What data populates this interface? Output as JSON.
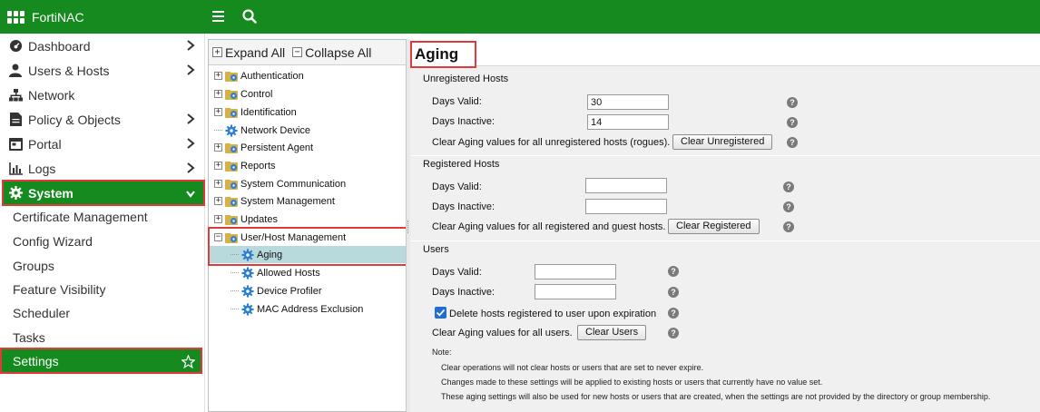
{
  "app": {
    "title": "FortiNAC"
  },
  "colors": {
    "brand_green": "#148a1f",
    "highlight_red": "#e03a3a",
    "tree_selected": "#b9dadd"
  },
  "topbar": {
    "menu_icon": "hamburger-menu-icon",
    "search_icon": "search-icon"
  },
  "nav": {
    "items": [
      {
        "label": "Dashboard",
        "icon": "dashboard-gauge-icon"
      },
      {
        "label": "Users & Hosts",
        "icon": "user-icon"
      },
      {
        "label": "Network",
        "icon": "network-icon"
      },
      {
        "label": "Policy & Objects",
        "icon": "policy-document-icon"
      },
      {
        "label": "Portal",
        "icon": "portal-icon"
      },
      {
        "label": "Logs",
        "icon": "logs-chart-icon"
      },
      {
        "label": "System",
        "icon": "gear-icon"
      }
    ],
    "system_sub": [
      {
        "label": "Certificate Management"
      },
      {
        "label": "Config Wizard"
      },
      {
        "label": "Groups"
      },
      {
        "label": "Feature Visibility"
      },
      {
        "label": "Scheduler"
      },
      {
        "label": "Tasks"
      },
      {
        "label": "Settings"
      }
    ]
  },
  "tree": {
    "expand_all": "Expand All",
    "collapse_all": "Collapse All",
    "nodes": [
      {
        "label": "Authentication"
      },
      {
        "label": "Control"
      },
      {
        "label": "Identification"
      },
      {
        "label": "Network Device"
      },
      {
        "label": "Persistent Agent"
      },
      {
        "label": "Reports"
      },
      {
        "label": "System Communication"
      },
      {
        "label": "System Management"
      },
      {
        "label": "Updates"
      },
      {
        "label": "User/Host Management"
      },
      {
        "label": "Aging"
      },
      {
        "label": "Allowed Hosts"
      },
      {
        "label": "Device Profiler"
      },
      {
        "label": "MAC Address Exclusion"
      }
    ]
  },
  "main": {
    "title": "Aging",
    "unregistered": {
      "heading": "Unregistered Hosts",
      "days_valid_label": "Days Valid:",
      "days_valid_value": "30",
      "days_inactive_label": "Days Inactive:",
      "days_inactive_value": "14",
      "clear_label": "Clear Aging values for all unregistered hosts (rogues).",
      "clear_button": "Clear Unregistered"
    },
    "registered": {
      "heading": "Registered Hosts",
      "days_valid_label": "Days Valid:",
      "days_valid_value": "",
      "days_inactive_label": "Days Inactive:",
      "days_inactive_value": "",
      "clear_label": "Clear Aging values for all registered and guest hosts.",
      "clear_button": "Clear Registered"
    },
    "users": {
      "heading": "Users",
      "days_valid_label": "Days Valid:",
      "days_valid_value": "",
      "days_inactive_label": "Days Inactive:",
      "days_inactive_value": "",
      "delete_label": "Delete hosts registered to user upon expiration",
      "delete_checked": true,
      "clear_label": "Clear Aging values for all users.",
      "clear_button": "Clear Users"
    },
    "help_glyph": "?",
    "note_heading": "Note:",
    "notes": [
      "Clear operations will not clear hosts or users that are set to never expire.",
      "Changes made to these settings will be applied to existing hosts or users that currently have no value set.",
      "These aging settings will also be used for new hosts or users that are created, when the settings are not provided by the directory or group membership."
    ]
  }
}
